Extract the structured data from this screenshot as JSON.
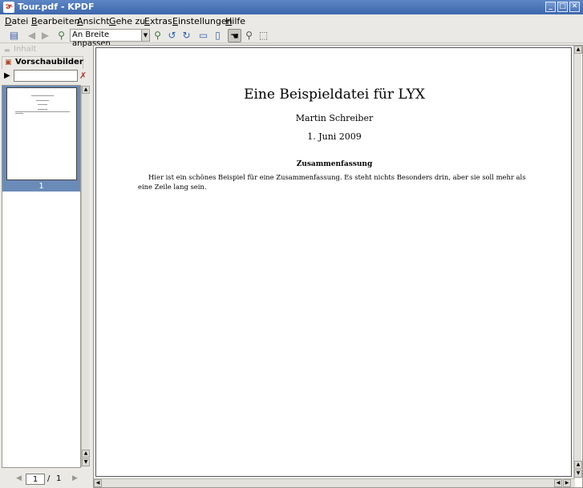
{
  "window": {
    "title": "Tour.pdf - KPDF"
  },
  "menu": [
    "Datei",
    "Bearbeiten",
    "Ansicht",
    "Gehe zu",
    "Extras",
    "Einstellungen",
    "Hilfe"
  ],
  "toolbar": {
    "zoom_value": "An Breite anpassen"
  },
  "sidebar": {
    "tab_contents": "Inhalt",
    "tab_thumbnails": "Vorschaubilder",
    "filter_value": "",
    "thumbnail_page": "1"
  },
  "pagenav": {
    "current": "1",
    "separator": "/",
    "total": "1"
  },
  "document": {
    "title": "Eine Beispieldatei für LYX",
    "author": "Martin Schreiber",
    "date": "1. Juni 2009",
    "abstract_heading": "Zusammenfassung",
    "abstract_text": "Hier ist ein schönes Beispiel für eine Zusammenfassung. Es steht nichts Besonders drin, aber sie soll mehr als eine Zeile lang sein."
  },
  "icons": [
    "open-icon",
    "back-icon",
    "forward-icon",
    "zoom-in-icon",
    "zoom-out-icon",
    "rotate-left-icon",
    "rotate-right-icon",
    "single-page-icon",
    "facing-pages-icon",
    "browse-icon",
    "zoom-tool-icon",
    "select-tool-icon"
  ]
}
